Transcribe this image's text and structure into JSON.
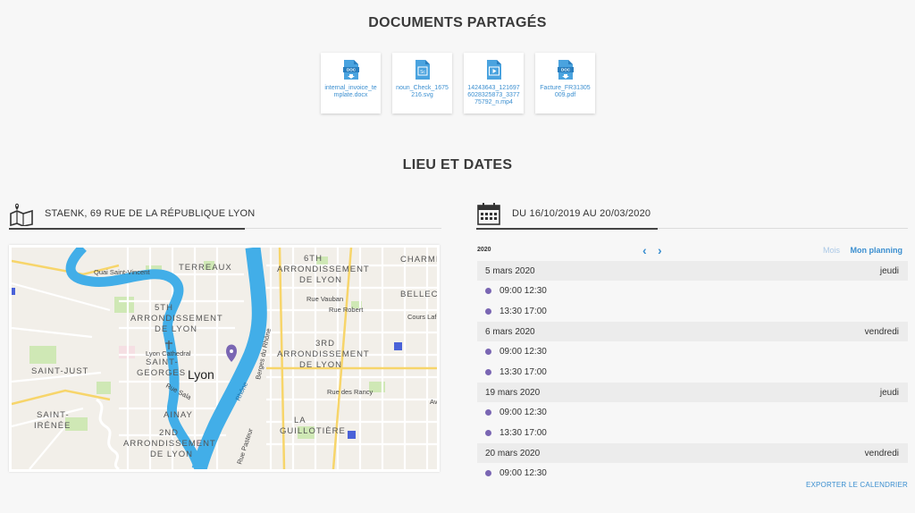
{
  "documents_section": {
    "title": "DOCUMENTS PARTAGÉS",
    "files": [
      {
        "name": "internal_invoice_template.docx",
        "icon": "doc-file-icon"
      },
      {
        "name": "noun_Check_1675216.svg",
        "icon": "svg-file-icon"
      },
      {
        "name": "14243643_1216976028325873_337775792_n.mp4",
        "icon": "video-file-icon"
      },
      {
        "name": "Facture_FR31305009.pdf",
        "icon": "doc-file-icon"
      }
    ]
  },
  "lieu_section": {
    "title": "LIEU ET DATES",
    "address": "STAENK, 69 RUE DE LA RÉPUBLIQUE LYON",
    "dates": "DU 16/10/2019 AU 20/03/2020"
  },
  "map": {
    "labels": {
      "quai": "Quai Saint-Vincent",
      "terreaux": "TERREAUX",
      "arr6_1": "6TH",
      "arr6_2": "ARRONDISSEMENT",
      "arr6_3": "DE LYON",
      "charmi": "CHARMI",
      "vauban": "Rue Vauban",
      "belleco": "BELLECO",
      "robert": "Rue Robert",
      "lafa": "Cours Laf",
      "arr5_1": "5TH",
      "arr5_2": "ARRONDISSEMENT",
      "arr5_3": "DE LYON",
      "arr3_1": "3RD",
      "arr3_2": "ARRONDISSEMENT",
      "arr3_3": "DE LYON",
      "cathedral": "Lyon Cathedral",
      "stgeorges1": "SAINT-",
      "stgeorges2": "GEORGES",
      "saintjust": "SAINT-JUST",
      "lyon": "Lyon",
      "sala": "Rue Sala",
      "berges": "Berges du Rhône",
      "rhone": "Rhône",
      "rancy": "Rue des Rancy",
      "sainti1": "SAINT-",
      "sainti2": "IRÉNÉE",
      "ainay": "AINAY",
      "arr2_1": "2ND",
      "arr2_2": "ARRONDISSEMENT",
      "arr2_3": "DE LYON",
      "guill1": "LA",
      "guill2": "GUILLOTIÈRE",
      "pasteur": "Rue Pasteur",
      "av": "Av"
    },
    "colors": {
      "water": "#42aee8",
      "land": "#f2efe9",
      "park": "#cfe8b5",
      "pin": "#7a66b3"
    }
  },
  "calendar": {
    "year": "2020",
    "prev_icon": "chevron-left-icon",
    "next_icon": "chevron-right-icon",
    "view_month": "Mois",
    "view_planning": "Mon planning",
    "days": [
      {
        "date": "5 mars 2020",
        "weekday": "jeudi",
        "slots": [
          "09:00 12:30",
          "13:30 17:00"
        ]
      },
      {
        "date": "6 mars 2020",
        "weekday": "vendredi",
        "slots": [
          "09:00 12:30",
          "13:30 17:00"
        ]
      },
      {
        "date": "19 mars 2020",
        "weekday": "jeudi",
        "slots": [
          "09:00 12:30",
          "13:30 17:00"
        ]
      },
      {
        "date": "20 mars 2020",
        "weekday": "vendredi",
        "slots": [
          "09:00 12:30"
        ]
      }
    ],
    "export_label": "EXPORTER LE CALENDRIER"
  }
}
